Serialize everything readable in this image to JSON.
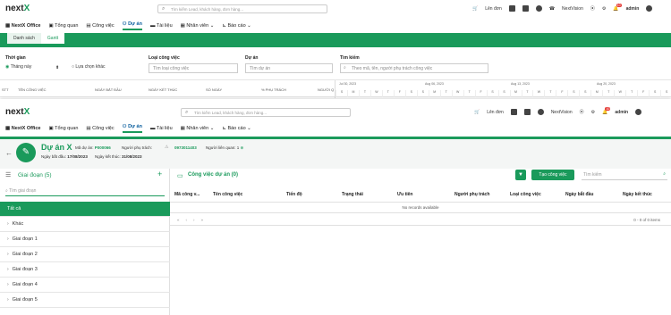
{
  "top1": {
    "logo_a": "next",
    "logo_b": "X",
    "search_placeholder": "Tìm kiếm Lead, khách hàng, đơn hàng...",
    "menu_title": "NextX Office",
    "nav": [
      "Tổng quan",
      "Công việc",
      "Dự án",
      "Tài liệu",
      "Nhân viên",
      "Báo cáo"
    ],
    "create_order": "Lên đơn",
    "company": "NextVision",
    "user": "admin",
    "bell_count": "10"
  },
  "gantt": {
    "tabs": [
      "Danh sách",
      "Gantt"
    ],
    "filters": {
      "time_label": "Thời gian",
      "month_option": "Tháng này",
      "other_option": "Lựa chọn khác",
      "type_label": "Loại công việc",
      "type_placeholder": "Tìm loại công việc",
      "project_label": "Dự án",
      "project_placeholder": "Tìm dự án",
      "search_label": "Tìm kiếm",
      "search_placeholder": "Theo mã, tên, người phụ trách công việc"
    },
    "columns": [
      "STT",
      "TÊN CÔNG VIỆC",
      "NGÀY BẮT ĐẦU",
      "NGÀY KẾT THÚC",
      "SỐ NGÀY",
      "% PHỤ TRÁCH",
      "NGƯỜI Q"
    ],
    "weeks": [
      "Jul 30, 2023",
      "Aug 06, 2023",
      "Aug 13, 2023",
      "Aug 20, 2023"
    ],
    "days": [
      "S",
      "M",
      "T",
      "W",
      "T",
      "F",
      "S",
      "S",
      "M",
      "T",
      "W",
      "T",
      "F",
      "S",
      "S",
      "M",
      "T",
      "W",
      "T",
      "F",
      "S",
      "S",
      "M",
      "T",
      "W",
      "T",
      "F",
      "S",
      "S"
    ]
  },
  "project": {
    "name": "Dự án X",
    "code_label": "Mã dự án:",
    "code": "P000066",
    "owner_label": "Người phụ trách:",
    "phone": "0973011403",
    "related_label": "Người liên quan:",
    "related_count": "1",
    "start_label": "Ngày bắt đầu:",
    "start": "17/08/2023",
    "end_label": "Ngày kết thúc:",
    "end": "31/08/2023"
  },
  "phases": {
    "title": "Giai đoạn (5)",
    "search_placeholder": "Tìm giai đoạn",
    "items": [
      "Tất cả",
      "Khác",
      "Giai đoạn 1",
      "Giai đoạn 2",
      "Giai đoạn 3",
      "Giai đoạn 4",
      "Giai đoạn 5"
    ]
  },
  "tasks": {
    "title": "Công việc dự án (0)",
    "create": "Tạo công việc",
    "search_placeholder": "Tìm kiếm",
    "columns": [
      "Mã công v...",
      "Tên công việc",
      "Tiến độ",
      "Trạng thái",
      "Ưu tiên",
      "Người phụ trách",
      "Loại công việc",
      "Ngày bắt đầu",
      "Ngày kết thúc"
    ],
    "empty": "No records available",
    "pager_info": "0 - 0 of 0 items"
  }
}
